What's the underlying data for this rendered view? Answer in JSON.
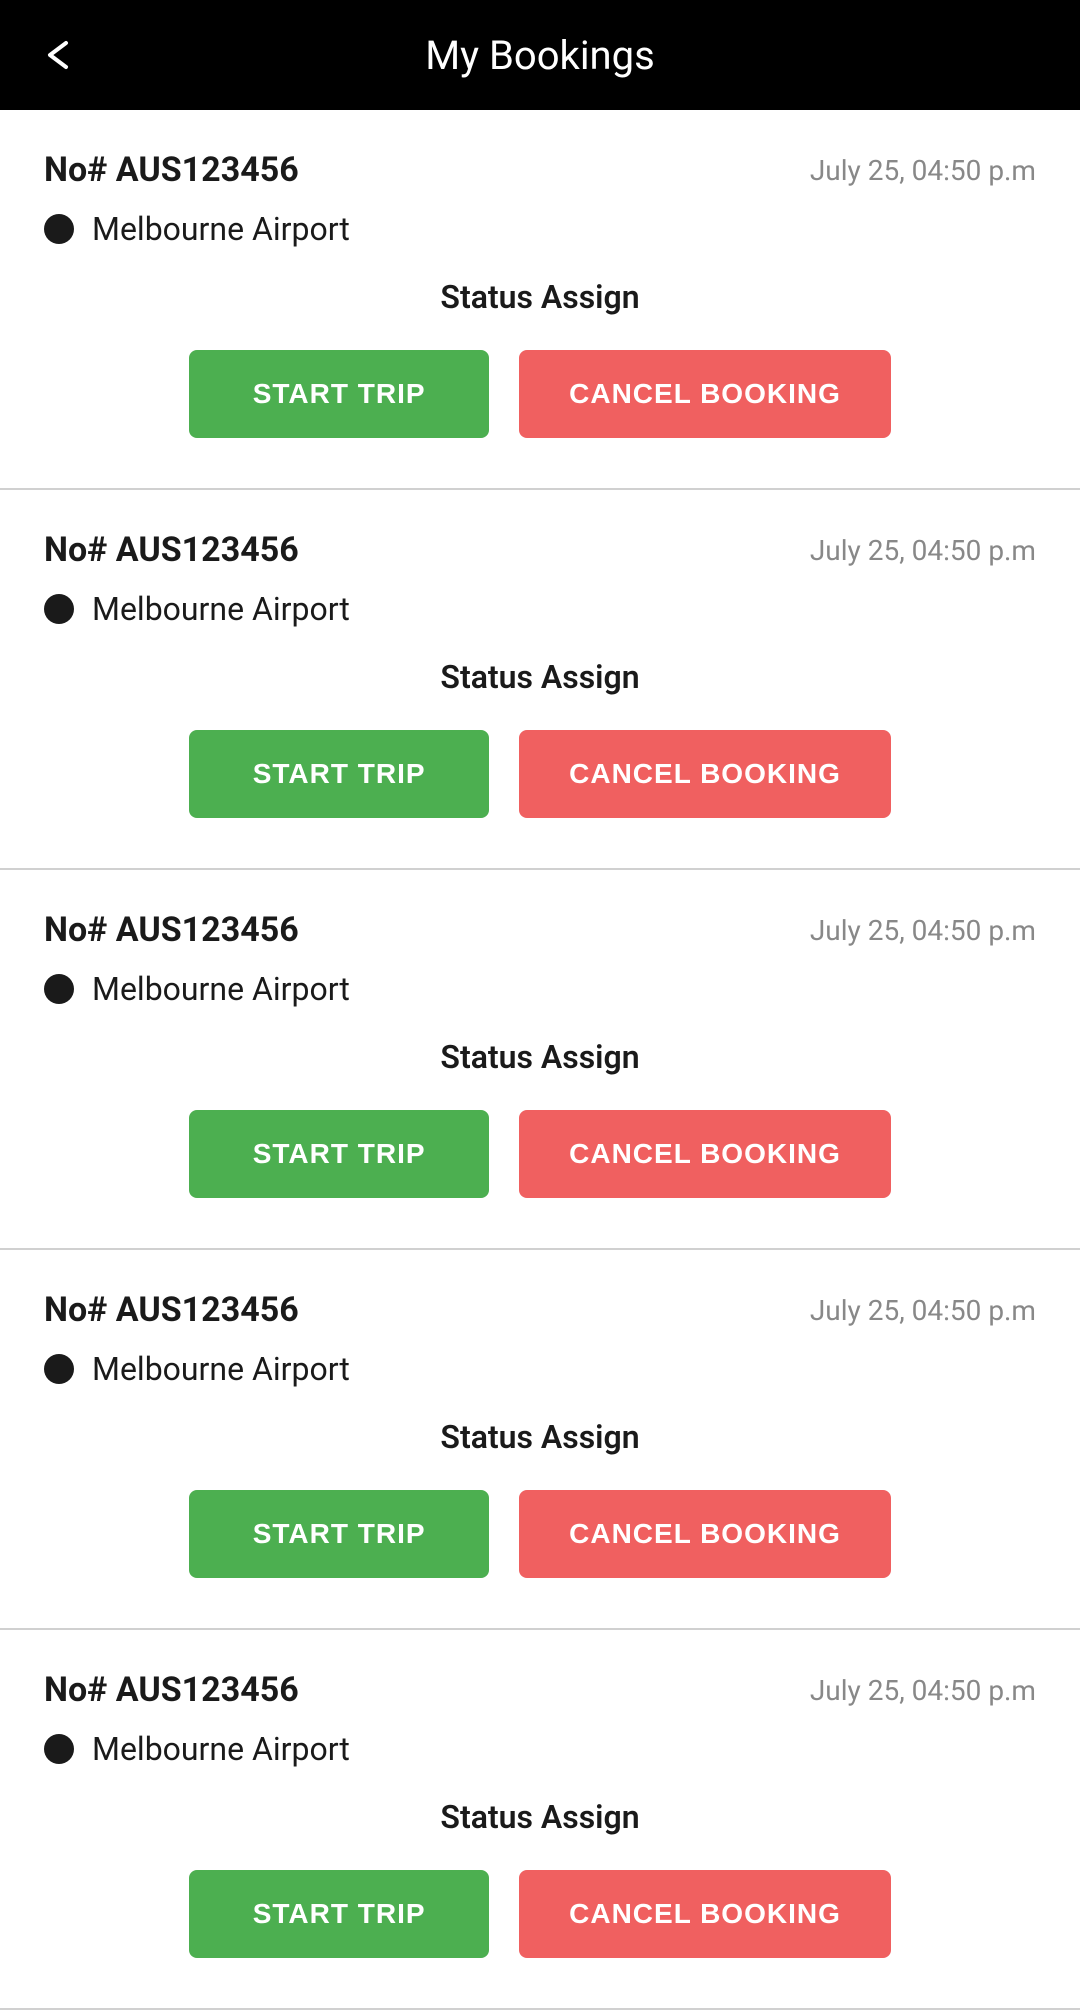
{
  "header": {
    "title": "My Bookings",
    "back_label": "←"
  },
  "bookings": [
    {
      "id": "booking-1",
      "number": "No# AUS123456",
      "date": "July 25, 04:50 p.m",
      "location": "Melbourne Airport",
      "status": "Status Assign",
      "start_trip_label": "START TRIP",
      "cancel_label": "CANCEL BOOKING"
    },
    {
      "id": "booking-2",
      "number": "No# AUS123456",
      "date": "July 25, 04:50 p.m",
      "location": "Melbourne Airport",
      "status": "Status Assign",
      "start_trip_label": "START TRIP",
      "cancel_label": "CANCEL BOOKING"
    },
    {
      "id": "booking-3",
      "number": "No# AUS123456",
      "date": "July 25, 04:50 p.m",
      "location": "Melbourne Airport",
      "status": "Status Assign",
      "start_trip_label": "START TRIP",
      "cancel_label": "CANCEL BOOKING"
    },
    {
      "id": "booking-4",
      "number": "No# AUS123456",
      "date": "July 25, 04:50 p.m",
      "location": "Melbourne Airport",
      "status": "Status Assign",
      "start_trip_label": "START TRIP",
      "cancel_label": "CANCEL BOOKING"
    },
    {
      "id": "booking-5",
      "number": "No# AUS123456",
      "date": "July 25, 04:50 p.m",
      "location": "Melbourne Airport",
      "status": "Status Assign",
      "start_trip_label": "START TRIP",
      "cancel_label": "CANCEL BOOKING"
    }
  ],
  "colors": {
    "header_bg": "#000000",
    "start_trip_bg": "#4caf50",
    "cancel_bg": "#f06060"
  }
}
